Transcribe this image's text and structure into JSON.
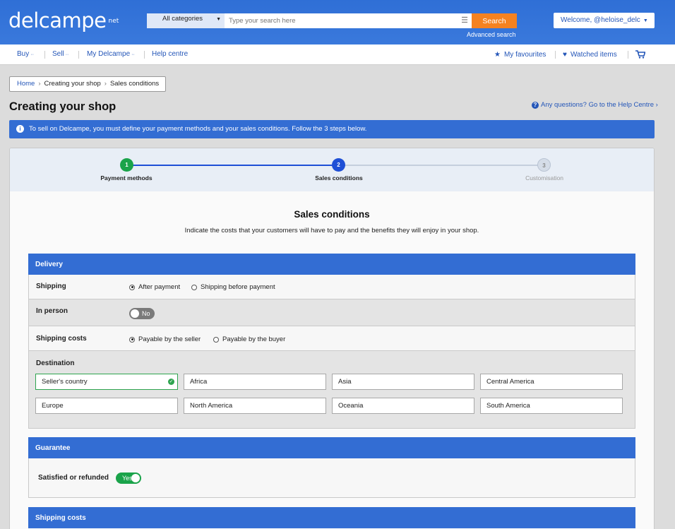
{
  "header": {
    "logo": "delcampe",
    "logo_suffix": "net",
    "category": "All categories",
    "search_placeholder": "Type your search here",
    "search_button": "Search",
    "advanced_search": "Advanced search",
    "welcome": "Welcome, @heloise_delc"
  },
  "nav": {
    "buy": "Buy",
    "sell": "Sell",
    "my_delcampe": "My Delcampe",
    "help": "Help centre",
    "favourites": "My favourites",
    "watched": "Watched items"
  },
  "breadcrumb": [
    "Home",
    "Creating your shop",
    "Sales conditions"
  ],
  "page": {
    "title": "Creating your shop",
    "help_link": "Any questions? Go to the Help Centre",
    "info": "To sell on Delcampe, you must define your payment methods and your sales conditions. Follow the 3 steps below."
  },
  "steps": [
    {
      "num": "1",
      "label": "Payment methods",
      "state": "done"
    },
    {
      "num": "2",
      "label": "Sales conditions",
      "state": "current"
    },
    {
      "num": "3",
      "label": "Customisation",
      "state": "todo"
    }
  ],
  "section": {
    "title": "Sales conditions",
    "subtitle": "Indicate the costs that your customers will have to pay and the benefits they will enjoy in your shop."
  },
  "delivery": {
    "title": "Delivery",
    "shipping_label": "Shipping",
    "shipping_opt1": "After payment",
    "shipping_opt2": "Shipping before payment",
    "in_person_label": "In person",
    "in_person_toggle": "No",
    "costs_label": "Shipping costs",
    "costs_opt1": "Payable by the seller",
    "costs_opt2": "Payable by the buyer",
    "destination_label": "Destination",
    "destinations": [
      "Seller's country",
      "Africa",
      "Asia",
      "Central America",
      "Europe",
      "North America",
      "Oceania",
      "South America"
    ]
  },
  "guarantee": {
    "title": "Guarantee",
    "label": "Satisfied or refunded",
    "toggle": "Yes"
  },
  "shipping_costs": {
    "title": "Shipping costs"
  },
  "colors": {
    "brand_blue": "#336dd3",
    "search_orange": "#f58220",
    "success_green": "#2ea44f"
  }
}
